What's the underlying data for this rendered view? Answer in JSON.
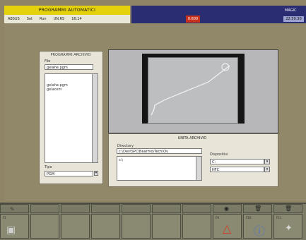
{
  "window": {
    "title": "PROGRAMMI AUTOMATICI",
    "status_right": "MAGIC",
    "status_alarm": "0.600",
    "status_chip": "22.59.30"
  },
  "menu": {
    "items": [
      "ABSUS",
      "Set",
      "Run",
      "UN.RS",
      "16:14"
    ]
  },
  "file_panel": {
    "title": "PROGRAMMI ARCHIVIO",
    "file_label": "File",
    "file_value": "gelahe.pgm",
    "list_items": [
      "gelahe.pgm",
      "gelacem"
    ],
    "type_label": "Tipo",
    "type_value": "PGM"
  },
  "unit_panel": {
    "title": "UNITA ARCHIVIO",
    "directory_label": "Directory",
    "directory_value": "c:\\Dev\\SPC\\Bearmo\\Tech\\Ov",
    "directory_sub": "c:\\",
    "drive_label": "Dispositivi",
    "drive_values": [
      "C:",
      "HFC"
    ]
  },
  "softkeys": {
    "left_icon": "pencil-icon",
    "center_icons": [
      "circle-icon",
      "trash-icon"
    ],
    "f1_label": "F1",
    "f9_label": "F9",
    "f10_label": "F10",
    "f11_label": "F11"
  },
  "colors": {
    "accent_yellow": "#e6d20c",
    "accent_blue": "#2b2d73",
    "alarm_red": "#c8321c"
  }
}
